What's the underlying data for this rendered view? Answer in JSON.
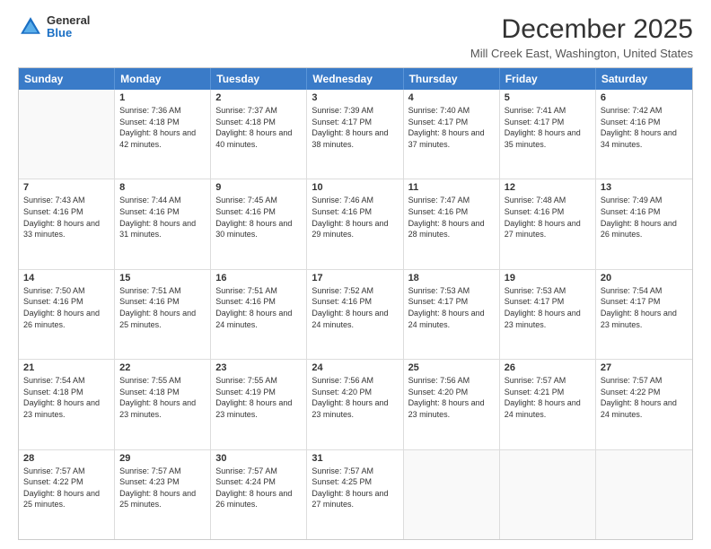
{
  "header": {
    "logo_general": "General",
    "logo_blue": "Blue",
    "month_title": "December 2025",
    "location": "Mill Creek East, Washington, United States"
  },
  "weekdays": [
    "Sunday",
    "Monday",
    "Tuesday",
    "Wednesday",
    "Thursday",
    "Friday",
    "Saturday"
  ],
  "weeks": [
    [
      {
        "day": "",
        "sunrise": "",
        "sunset": "",
        "daylight": ""
      },
      {
        "day": "1",
        "sunrise": "Sunrise: 7:36 AM",
        "sunset": "Sunset: 4:18 PM",
        "daylight": "Daylight: 8 hours and 42 minutes."
      },
      {
        "day": "2",
        "sunrise": "Sunrise: 7:37 AM",
        "sunset": "Sunset: 4:18 PM",
        "daylight": "Daylight: 8 hours and 40 minutes."
      },
      {
        "day": "3",
        "sunrise": "Sunrise: 7:39 AM",
        "sunset": "Sunset: 4:17 PM",
        "daylight": "Daylight: 8 hours and 38 minutes."
      },
      {
        "day": "4",
        "sunrise": "Sunrise: 7:40 AM",
        "sunset": "Sunset: 4:17 PM",
        "daylight": "Daylight: 8 hours and 37 minutes."
      },
      {
        "day": "5",
        "sunrise": "Sunrise: 7:41 AM",
        "sunset": "Sunset: 4:17 PM",
        "daylight": "Daylight: 8 hours and 35 minutes."
      },
      {
        "day": "6",
        "sunrise": "Sunrise: 7:42 AM",
        "sunset": "Sunset: 4:16 PM",
        "daylight": "Daylight: 8 hours and 34 minutes."
      }
    ],
    [
      {
        "day": "7",
        "sunrise": "Sunrise: 7:43 AM",
        "sunset": "Sunset: 4:16 PM",
        "daylight": "Daylight: 8 hours and 33 minutes."
      },
      {
        "day": "8",
        "sunrise": "Sunrise: 7:44 AM",
        "sunset": "Sunset: 4:16 PM",
        "daylight": "Daylight: 8 hours and 31 minutes."
      },
      {
        "day": "9",
        "sunrise": "Sunrise: 7:45 AM",
        "sunset": "Sunset: 4:16 PM",
        "daylight": "Daylight: 8 hours and 30 minutes."
      },
      {
        "day": "10",
        "sunrise": "Sunrise: 7:46 AM",
        "sunset": "Sunset: 4:16 PM",
        "daylight": "Daylight: 8 hours and 29 minutes."
      },
      {
        "day": "11",
        "sunrise": "Sunrise: 7:47 AM",
        "sunset": "Sunset: 4:16 PM",
        "daylight": "Daylight: 8 hours and 28 minutes."
      },
      {
        "day": "12",
        "sunrise": "Sunrise: 7:48 AM",
        "sunset": "Sunset: 4:16 PM",
        "daylight": "Daylight: 8 hours and 27 minutes."
      },
      {
        "day": "13",
        "sunrise": "Sunrise: 7:49 AM",
        "sunset": "Sunset: 4:16 PM",
        "daylight": "Daylight: 8 hours and 26 minutes."
      }
    ],
    [
      {
        "day": "14",
        "sunrise": "Sunrise: 7:50 AM",
        "sunset": "Sunset: 4:16 PM",
        "daylight": "Daylight: 8 hours and 26 minutes."
      },
      {
        "day": "15",
        "sunrise": "Sunrise: 7:51 AM",
        "sunset": "Sunset: 4:16 PM",
        "daylight": "Daylight: 8 hours and 25 minutes."
      },
      {
        "day": "16",
        "sunrise": "Sunrise: 7:51 AM",
        "sunset": "Sunset: 4:16 PM",
        "daylight": "Daylight: 8 hours and 24 minutes."
      },
      {
        "day": "17",
        "sunrise": "Sunrise: 7:52 AM",
        "sunset": "Sunset: 4:16 PM",
        "daylight": "Daylight: 8 hours and 24 minutes."
      },
      {
        "day": "18",
        "sunrise": "Sunrise: 7:53 AM",
        "sunset": "Sunset: 4:17 PM",
        "daylight": "Daylight: 8 hours and 24 minutes."
      },
      {
        "day": "19",
        "sunrise": "Sunrise: 7:53 AM",
        "sunset": "Sunset: 4:17 PM",
        "daylight": "Daylight: 8 hours and 23 minutes."
      },
      {
        "day": "20",
        "sunrise": "Sunrise: 7:54 AM",
        "sunset": "Sunset: 4:17 PM",
        "daylight": "Daylight: 8 hours and 23 minutes."
      }
    ],
    [
      {
        "day": "21",
        "sunrise": "Sunrise: 7:54 AM",
        "sunset": "Sunset: 4:18 PM",
        "daylight": "Daylight: 8 hours and 23 minutes."
      },
      {
        "day": "22",
        "sunrise": "Sunrise: 7:55 AM",
        "sunset": "Sunset: 4:18 PM",
        "daylight": "Daylight: 8 hours and 23 minutes."
      },
      {
        "day": "23",
        "sunrise": "Sunrise: 7:55 AM",
        "sunset": "Sunset: 4:19 PM",
        "daylight": "Daylight: 8 hours and 23 minutes."
      },
      {
        "day": "24",
        "sunrise": "Sunrise: 7:56 AM",
        "sunset": "Sunset: 4:20 PM",
        "daylight": "Daylight: 8 hours and 23 minutes."
      },
      {
        "day": "25",
        "sunrise": "Sunrise: 7:56 AM",
        "sunset": "Sunset: 4:20 PM",
        "daylight": "Daylight: 8 hours and 23 minutes."
      },
      {
        "day": "26",
        "sunrise": "Sunrise: 7:57 AM",
        "sunset": "Sunset: 4:21 PM",
        "daylight": "Daylight: 8 hours and 24 minutes."
      },
      {
        "day": "27",
        "sunrise": "Sunrise: 7:57 AM",
        "sunset": "Sunset: 4:22 PM",
        "daylight": "Daylight: 8 hours and 24 minutes."
      }
    ],
    [
      {
        "day": "28",
        "sunrise": "Sunrise: 7:57 AM",
        "sunset": "Sunset: 4:22 PM",
        "daylight": "Daylight: 8 hours and 25 minutes."
      },
      {
        "day": "29",
        "sunrise": "Sunrise: 7:57 AM",
        "sunset": "Sunset: 4:23 PM",
        "daylight": "Daylight: 8 hours and 25 minutes."
      },
      {
        "day": "30",
        "sunrise": "Sunrise: 7:57 AM",
        "sunset": "Sunset: 4:24 PM",
        "daylight": "Daylight: 8 hours and 26 minutes."
      },
      {
        "day": "31",
        "sunrise": "Sunrise: 7:57 AM",
        "sunset": "Sunset: 4:25 PM",
        "daylight": "Daylight: 8 hours and 27 minutes."
      },
      {
        "day": "",
        "sunrise": "",
        "sunset": "",
        "daylight": ""
      },
      {
        "day": "",
        "sunrise": "",
        "sunset": "",
        "daylight": ""
      },
      {
        "day": "",
        "sunrise": "",
        "sunset": "",
        "daylight": ""
      }
    ]
  ]
}
